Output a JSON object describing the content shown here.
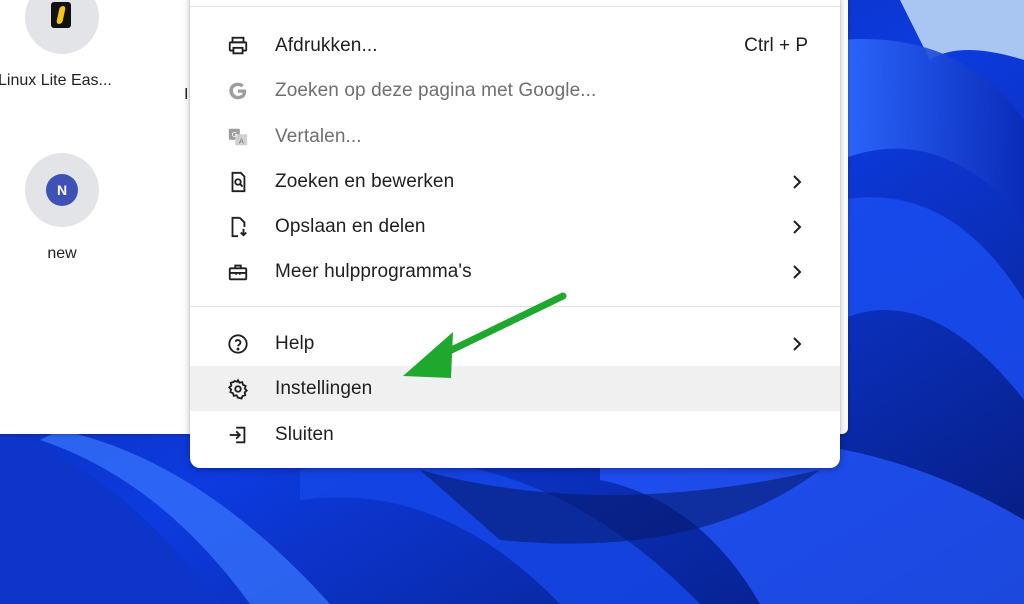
{
  "colors": {
    "arrow": "#1fa82e",
    "menu_background": "#ffffff",
    "hover_background": "#f0f0f0",
    "wallpaper_primary": "#0b3bd9"
  },
  "shortcuts": [
    {
      "label": "Linux Lite Eas...",
      "icon": "linux-lite-logo"
    },
    {
      "label": "new",
      "icon": "letter-avatar",
      "avatar_letter": "N"
    }
  ],
  "partial_label": "I",
  "menu": {
    "items": [
      {
        "id": "print",
        "label": "Afdrukken...",
        "shortcut": "Ctrl + P",
        "icon": "printer-icon",
        "submenu": false
      },
      {
        "id": "search-google",
        "label": "Zoeken op deze pagina met Google...",
        "icon": "google-g-icon",
        "submenu": false,
        "disabled": true
      },
      {
        "id": "translate",
        "label": "Vertalen...",
        "icon": "translate-icon",
        "submenu": false,
        "disabled": true
      },
      {
        "id": "find-edit",
        "label": "Zoeken en bewerken",
        "icon": "find-page-icon",
        "submenu": true
      },
      {
        "id": "save-share",
        "label": "Opslaan en delen",
        "icon": "save-file-icon",
        "submenu": true
      },
      {
        "id": "more-tools",
        "label": "Meer hulpprogramma's",
        "icon": "toolbox-icon",
        "submenu": true
      },
      {
        "id": "help",
        "label": "Help",
        "icon": "help-circle-icon",
        "submenu": true
      },
      {
        "id": "settings",
        "label": "Instellingen",
        "icon": "gear-icon",
        "submenu": false,
        "highlighted": true
      },
      {
        "id": "exit",
        "label": "Sluiten",
        "icon": "exit-icon",
        "submenu": false
      }
    ]
  }
}
